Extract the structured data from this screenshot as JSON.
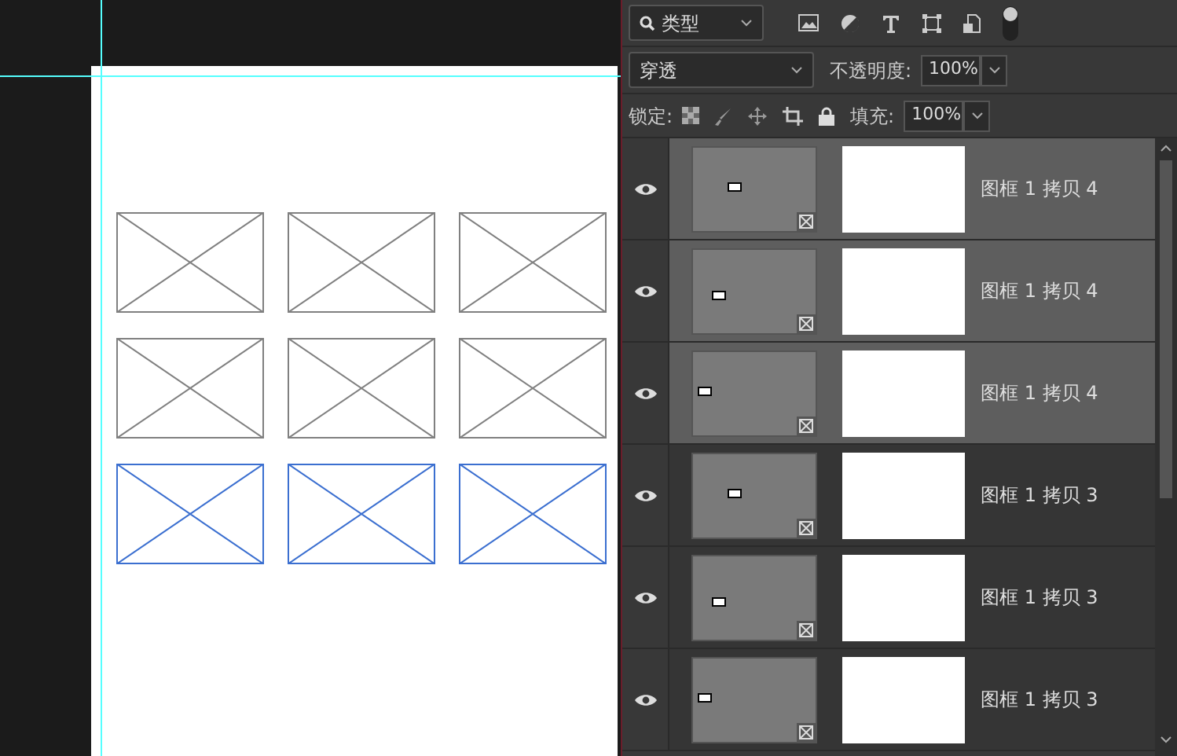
{
  "canvas": {
    "frames": [
      {
        "selected": false
      },
      {
        "selected": false
      },
      {
        "selected": false
      },
      {
        "selected": false
      },
      {
        "selected": false
      },
      {
        "selected": false
      },
      {
        "selected": true
      },
      {
        "selected": true
      },
      {
        "selected": true
      }
    ]
  },
  "layers_panel": {
    "filter": {
      "value": "类型"
    },
    "blend_mode": {
      "value": "穿透"
    },
    "opacity": {
      "label": "不透明度:",
      "value": "100%"
    },
    "lock": {
      "label": "锁定:"
    },
    "fill": {
      "label": "填充:",
      "value": "100%"
    },
    "layers": [
      {
        "name": "图框 1 拷贝 4",
        "visible": true,
        "selected": true
      },
      {
        "name": "图框 1 拷贝 4",
        "visible": true,
        "selected": true
      },
      {
        "name": "图框 1 拷贝 4",
        "visible": true,
        "selected": true
      },
      {
        "name": "图框 1 拷贝 3",
        "visible": true,
        "selected": false
      },
      {
        "name": "图框 1 拷贝 3",
        "visible": true,
        "selected": false
      },
      {
        "name": "图框 1 拷贝 3",
        "visible": true,
        "selected": false
      }
    ]
  }
}
